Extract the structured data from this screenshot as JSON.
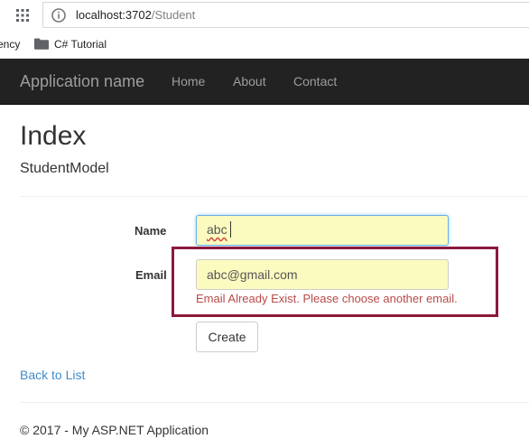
{
  "browser": {
    "url_host": "localhost:3702",
    "url_path": "/Student",
    "bookmarks": [
      {
        "label": "ency"
      },
      {
        "label": "C# Tutorial"
      }
    ]
  },
  "navbar": {
    "brand": "Application name",
    "links": [
      {
        "label": "Home"
      },
      {
        "label": "About"
      },
      {
        "label": "Contact"
      }
    ],
    "background": "#222222",
    "text_color": "#9d9d9d"
  },
  "page": {
    "title": "Index",
    "subtitle": "StudentModel"
  },
  "form": {
    "name": {
      "label": "Name",
      "value": "abc"
    },
    "email": {
      "label": "Email",
      "value": "abc@gmail.com",
      "error": "Email Already Exist. Please choose another email."
    },
    "submit_label": "Create",
    "autofill_color": "#fbfbbf",
    "error_color": "#b94a48",
    "highlight_color": "#8b1a3a"
  },
  "links": {
    "back_to_list": "Back to List"
  },
  "footer": {
    "text": "© 2017 - My ASP.NET Application"
  }
}
